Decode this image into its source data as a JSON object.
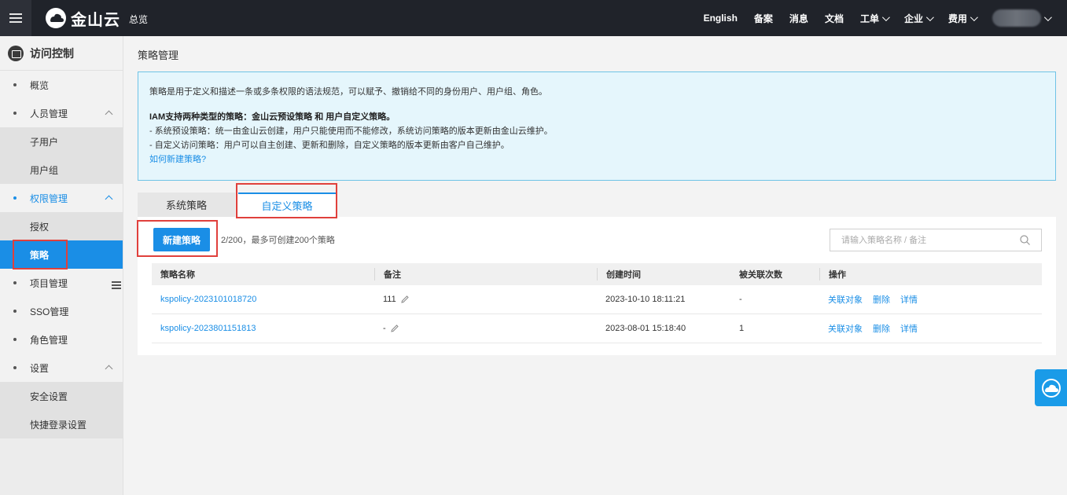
{
  "topbar": {
    "brand": "金山云",
    "overview": "总览",
    "nav": [
      {
        "label": "English",
        "has_dropdown": false
      },
      {
        "label": "备案",
        "has_dropdown": false
      },
      {
        "label": "消息",
        "has_dropdown": false
      },
      {
        "label": "文档",
        "has_dropdown": false
      },
      {
        "label": "工单",
        "has_dropdown": true
      },
      {
        "label": "企业",
        "has_dropdown": true
      },
      {
        "label": "费用",
        "has_dropdown": true
      }
    ]
  },
  "sidebar": {
    "title": "访问控制",
    "items": {
      "overview": "概览",
      "people": "人员管理",
      "subuser": "子用户",
      "usergroup": "用户组",
      "permission": "权限管理",
      "authorize": "授权",
      "policy": "策略",
      "project": "项目管理",
      "sso": "SSO管理",
      "role": "角色管理",
      "settings": "设置",
      "security": "安全设置",
      "quicklogin": "快捷登录设置"
    }
  },
  "main": {
    "title": "策略管理",
    "info": {
      "line1": "策略是用于定义和描述一条或多条权限的语法规范，可以赋予、撤销给不同的身份用户、用户组、角色。",
      "heading": "IAM支持两种类型的策略：金山云预设策略 和 用户自定义策略。",
      "line2": "- 系统预设策略：统一由金山云创建，用户只能使用而不能修改，系统访问策略的版本更新由金山云维护。",
      "line3": "- 自定义访问策略：用户可以自主创建、更新和删除，自定义策略的版本更新由客户自己维护。",
      "link": "如何新建策略?"
    },
    "tabs": {
      "system": "系统策略",
      "custom": "自定义策略"
    },
    "new_button": "新建策略",
    "quota": "2/200，最多可创建200个策略",
    "search_placeholder": "请输入策略名称 / 备注",
    "table": {
      "headers": {
        "name": "策略名称",
        "remark": "备注",
        "created": "创建时间",
        "linked": "被关联次数",
        "actions": "操作"
      },
      "rows": [
        {
          "name": "kspolicy-2023101018720",
          "remark": "111",
          "created": "2023-10-10 18:11:21",
          "linked": "-",
          "action_link": "关联对象",
          "action_delete": "删除",
          "action_detail": "详情"
        },
        {
          "name": "kspolicy-2023801151813",
          "remark": "-",
          "created": "2023-08-01 15:18:40",
          "linked": "1",
          "action_link": "关联对象",
          "action_delete": "删除",
          "action_detail": "详情"
        }
      ]
    }
  },
  "colors": {
    "accent": "#1a8ee6",
    "topbar": "#20232a",
    "highlight": "#e0403c",
    "info_bg": "#e5f6fc"
  }
}
